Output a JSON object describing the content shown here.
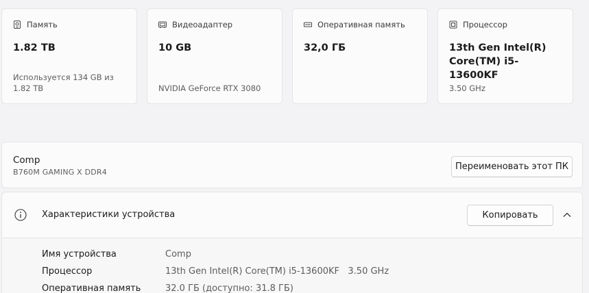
{
  "cards": [
    {
      "title": "Память",
      "icon": "storage-icon",
      "value": "1.82 TB",
      "sub": "Используется 134 GB из 1.82 TB"
    },
    {
      "title": "Видеоадаптер",
      "icon": "gpu-icon",
      "value": "10 GB",
      "sub": "NVIDIA GeForce RTX 3080"
    },
    {
      "title": "Оперативная память",
      "icon": "ram-icon",
      "value": "32,0 ГБ",
      "sub": ""
    },
    {
      "title": "Процессор",
      "icon": "cpu-icon",
      "value": "13th Gen Intel(R) Core(TM) i5-13600KF",
      "sub": "3.50 GHz"
    }
  ],
  "computer": {
    "name": "Comp",
    "model": "B760M GAMING X DDR4",
    "rename_label": "Переименовать этот ПК"
  },
  "specs": {
    "title": "Характеристики устройства",
    "copy_label": "Копировать",
    "rows": [
      {
        "label": "Имя устройства",
        "value": "Comp"
      },
      {
        "label": "Процессор",
        "value": "13th Gen Intel(R) Core(TM) i5-13600KF   3.50 GHz"
      },
      {
        "label": "Оперативная память",
        "value": "32.0 ГБ (доступно: 31.8 ГБ)"
      }
    ]
  }
}
